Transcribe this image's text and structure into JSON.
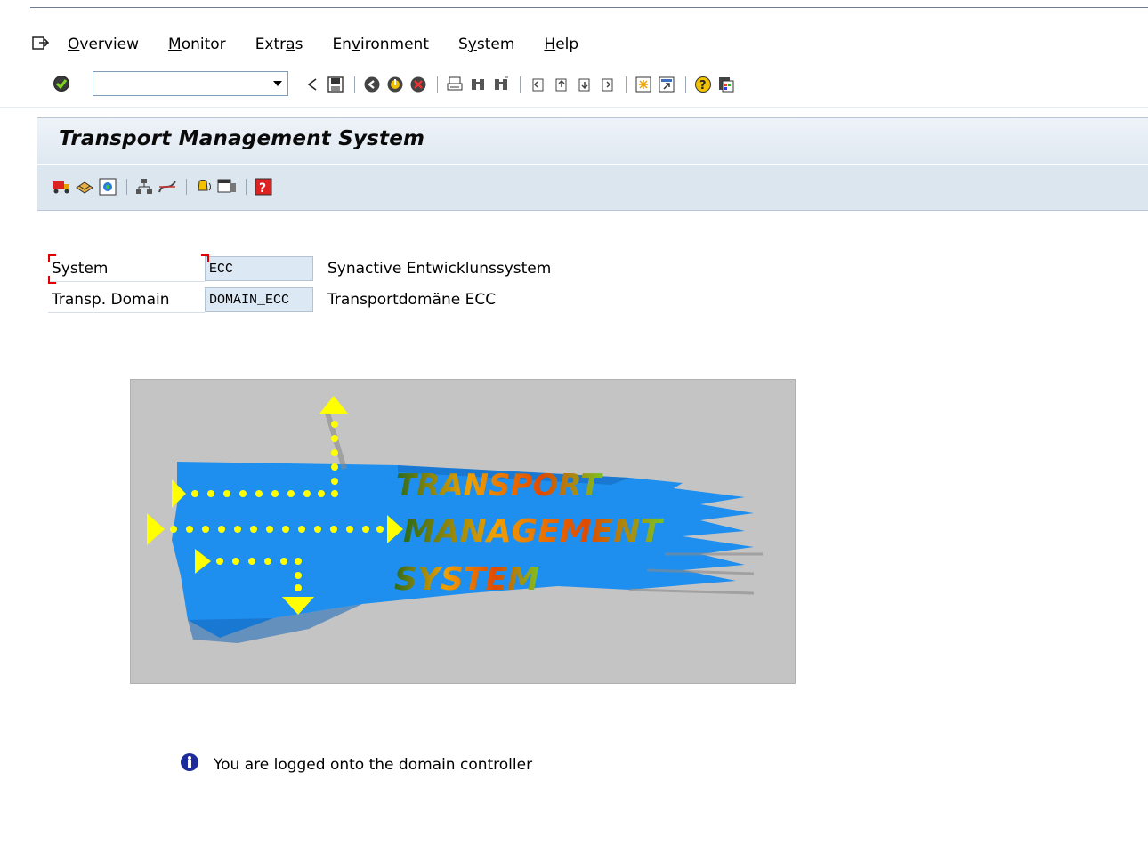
{
  "menubar": {
    "items": [
      {
        "label": "Overview"
      },
      {
        "label": "Monitor"
      },
      {
        "label": "Extras"
      },
      {
        "label": "Environment"
      },
      {
        "label": "System"
      },
      {
        "label": "Help"
      }
    ]
  },
  "toolbar": {
    "command_field_value": "",
    "icons": [
      "enter-check-icon",
      "back-arrow-icon",
      "save-icon",
      "back-icon",
      "exit-icon",
      "cancel-icon",
      "print-icon",
      "find-icon",
      "find-next-icon",
      "first-page-icon",
      "previous-page-icon",
      "next-page-icon",
      "last-page-icon",
      "create-session-icon",
      "shortcut-icon",
      "help-icon",
      "customize-layout-icon"
    ]
  },
  "title": "Transport Management System",
  "app_toolbar": {
    "icons": [
      "transport-truck-icon",
      "import-overview-icon",
      "import-monitor-icon",
      "transport-routes-icon",
      "transport-strategy-icon",
      "alert-monitor-icon",
      "system-overview-icon",
      "question-icon"
    ]
  },
  "fields": {
    "system": {
      "label": "System",
      "value": "ECC",
      "description": "Synactive Entwicklunssystem"
    },
    "domain": {
      "label": "Transp. Domain",
      "value": "DOMAIN_ECC",
      "description": "Transportdomäne ECC"
    }
  },
  "logo": {
    "line1": "TRANSPORT",
    "line2": "MANAGEMENT",
    "line3": "SYSTEM"
  },
  "info_message": "You are logged onto the domain controller",
  "colors": {
    "accent_blue": "#1e8fef",
    "arrow_yellow": "#ffff00",
    "logo_bg": "#c4c4c4",
    "title_bg": "#dce6ef"
  }
}
